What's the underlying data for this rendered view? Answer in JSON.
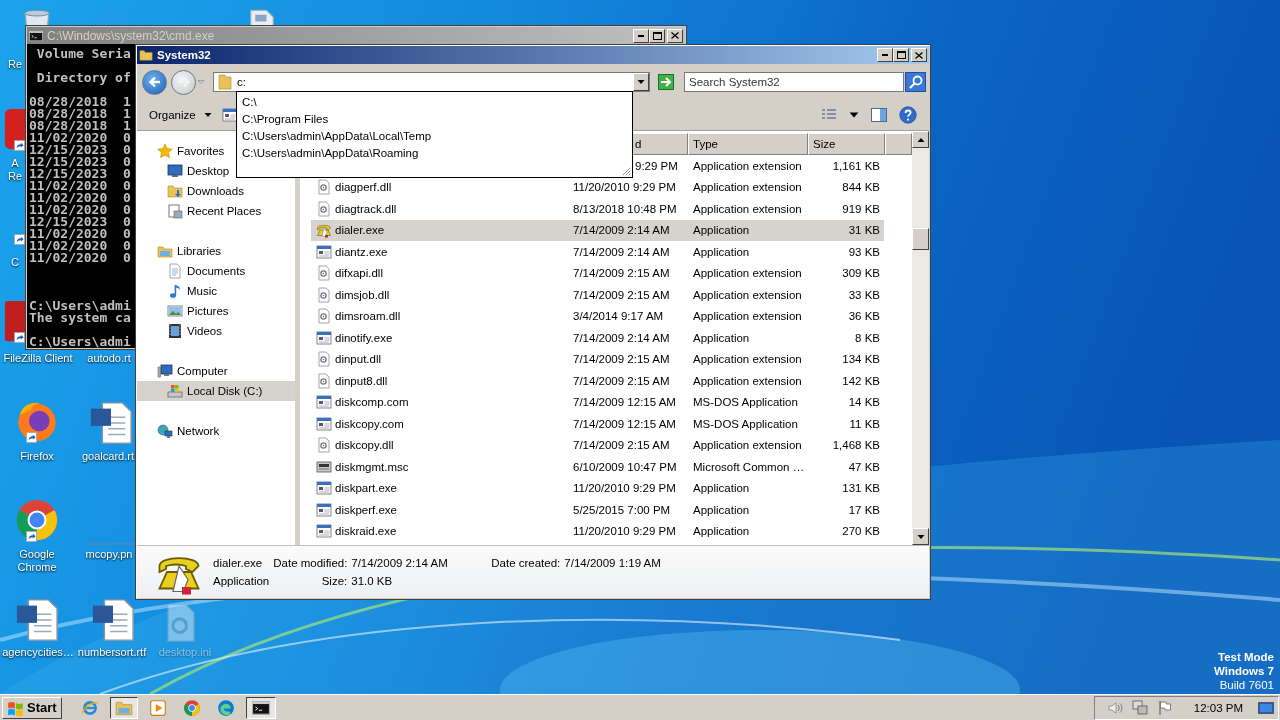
{
  "desktop_icons": [
    {
      "kind": "bin",
      "label": "Re",
      "shortcut": false
    },
    {
      "kind": "bubble",
      "shortcut": false
    },
    {
      "kind": "document",
      "shortcut": false
    },
    {
      "kind": "acrobat",
      "label": "A Re",
      "shortcut": true
    },
    {
      "kind": "none",
      "label": "C",
      "shortcut": true
    },
    {
      "kind": "filezilla",
      "label": "FileZilla Client",
      "shortcut": true
    },
    {
      "kind": "none",
      "label": "autodo.rt",
      "shortcut": false
    },
    {
      "kind": "firefox",
      "label": "Firefox",
      "shortcut": true
    },
    {
      "kind": "word",
      "label": "goalcard.rt",
      "shortcut": false
    },
    {
      "kind": "chrome",
      "label": "Google Chrome",
      "shortcut": true
    },
    {
      "kind": "thumb",
      "label": "mcopy.pn",
      "shortcut": false
    },
    {
      "kind": "word",
      "label": "agencycities…",
      "shortcut": false
    },
    {
      "kind": "word",
      "label": "numbersort.rtf",
      "shortcut": false
    },
    {
      "kind": "ini",
      "label": "desktop.ini",
      "shortcut": false
    }
  ],
  "system_notice": [
    {
      "text": "Test Mode",
      "emphasis": true
    },
    {
      "text": "Windows 7",
      "emphasis": true
    },
    {
      "text": "Build 7601",
      "emphasis": false
    }
  ],
  "console_window": {
    "title": "C:\\Windows\\system32\\cmd.exe",
    "blocks": [
      [
        " Volume Seria"
      ],
      [
        " Directory of"
      ],
      [
        "08/28/2018  1",
        "08/28/2018  1",
        "08/28/2018  1",
        "11/02/2020  0",
        "12/15/2023  0",
        "12/15/2023  0",
        "12/15/2023  0",
        "11/02/2020  0",
        "11/02/2020  0",
        "11/02/2020  0",
        "12/15/2023  0",
        "11/02/2020  0",
        "11/02/2020  0",
        "11/02/2020  0"
      ],
      [
        "C:\\Users\\admi",
        "The system ca"
      ],
      [
        "C:\\Users\\admi"
      ]
    ]
  },
  "explorer_window": {
    "title": "System32",
    "address": "c:",
    "search_placeholder": "Search System32",
    "autocomplete": [
      "C:\\",
      "C:\\Program Files",
      "C:\\Users\\admin\\AppData\\Local\\Temp",
      "C:\\Users\\admin\\AppData\\Roaming"
    ],
    "organize": "Organize",
    "nav": [
      {
        "label": "Favorites",
        "kind": "star",
        "selected": false,
        "children": [
          {
            "label": "Desktop",
            "kind": "desktop",
            "selected": false
          },
          {
            "label": "Downloads",
            "kind": "downloads",
            "selected": false
          },
          {
            "label": "Recent Places",
            "kind": "recent",
            "selected": false
          }
        ]
      },
      {
        "label": "Libraries",
        "kind": "library",
        "selected": false,
        "children": [
          {
            "label": "Documents",
            "kind": "documents",
            "selected": false
          },
          {
            "label": "Music",
            "kind": "music",
            "selected": false
          },
          {
            "label": "Pictures",
            "kind": "pictures",
            "selected": false
          },
          {
            "label": "Videos",
            "kind": "videos",
            "selected": false
          }
        ]
      },
      {
        "label": "Computer",
        "kind": "computer",
        "selected": false,
        "children": [
          {
            "label": "Local Disk (C:)",
            "kind": "disk",
            "selected": true
          }
        ]
      },
      {
        "label": "Network",
        "kind": "network",
        "selected": false
      }
    ],
    "columns": [
      "d",
      "Type",
      "Size"
    ],
    "files": [
      {
        "kind": "partial",
        "modified": "9:29 PM",
        "type": "Application extension",
        "size": "1,161 KB",
        "selected": false
      },
      {
        "kind": "extension",
        "name": "diagperf.dll",
        "modified": "11/20/2010 9:29 PM",
        "type": "Application extension",
        "size": "844 KB",
        "selected": false
      },
      {
        "kind": "extension",
        "name": "diagtrack.dll",
        "modified": "8/13/2018 10:48 PM",
        "type": "Application extension",
        "size": "919 KB",
        "selected": false
      },
      {
        "kind": "phone",
        "name": "dialer.exe",
        "modified": "7/14/2009 2:14 AM",
        "type": "Application",
        "size": "31 KB",
        "selected": true
      },
      {
        "kind": "window",
        "name": "diantz.exe",
        "modified": "7/14/2009 2:14 AM",
        "type": "Application",
        "size": "93 KB",
        "selected": false
      },
      {
        "kind": "extension",
        "name": "difxapi.dll",
        "modified": "7/14/2009 2:15 AM",
        "type": "Application extension",
        "size": "309 KB",
        "selected": false
      },
      {
        "kind": "extension",
        "name": "dimsjob.dll",
        "modified": "7/14/2009 2:15 AM",
        "type": "Application extension",
        "size": "33 KB",
        "selected": false
      },
      {
        "kind": "extension",
        "name": "dimsroam.dll",
        "modified": "3/4/2014 9:17 AM",
        "type": "Application extension",
        "size": "36 KB",
        "selected": false
      },
      {
        "kind": "window",
        "name": "dinotify.exe",
        "modified": "7/14/2009 2:14 AM",
        "type": "Application",
        "size": "8 KB",
        "selected": false
      },
      {
        "kind": "extension",
        "name": "dinput.dll",
        "modified": "7/14/2009 2:15 AM",
        "type": "Application extension",
        "size": "134 KB",
        "selected": false
      },
      {
        "kind": "extension",
        "name": "dinput8.dll",
        "modified": "7/14/2009 2:15 AM",
        "type": "Application extension",
        "size": "142 KB",
        "selected": false
      },
      {
        "kind": "window",
        "name": "diskcomp.com",
        "modified": "7/14/2009 12:15 AM",
        "type": "MS-DOS Application",
        "size": "14 KB",
        "selected": false
      },
      {
        "kind": "window",
        "name": "diskcopy.com",
        "modified": "7/14/2009 12:15 AM",
        "type": "MS-DOS Application",
        "size": "11 KB",
        "selected": false
      },
      {
        "kind": "extension",
        "name": "diskcopy.dll",
        "modified": "7/14/2009 2:15 AM",
        "type": "Application extension",
        "size": "1,468 KB",
        "selected": false
      },
      {
        "kind": "console",
        "name": "diskmgmt.msc",
        "modified": "6/10/2009 10:47 PM",
        "type": "Microsoft Common …",
        "size": "47 KB",
        "selected": false
      },
      {
        "kind": "window",
        "name": "diskpart.exe",
        "modified": "11/20/2010 9:29 PM",
        "type": "Application",
        "size": "131 KB",
        "selected": false
      },
      {
        "kind": "window",
        "name": "diskperf.exe",
        "modified": "5/25/2015 7:00 PM",
        "type": "Application",
        "size": "17 KB",
        "selected": false
      },
      {
        "kind": "window",
        "name": "diskraid.exe",
        "modified": "11/20/2010 9:29 PM",
        "type": "Application",
        "size": "270 KB",
        "selected": false
      }
    ],
    "details": {
      "kind": "phone",
      "name": "dialer.exe",
      "type": "Application",
      "fields": [
        {
          "label": "Date modified:",
          "value": "7/14/2009 2:14 AM"
        },
        {
          "label": "Date created:",
          "value": "7/14/2009 1:19 AM"
        },
        {
          "label": "Size:",
          "value": "31.0 KB"
        }
      ]
    }
  },
  "taskbar": {
    "start": "Start",
    "apps": [
      {
        "kind": "ie",
        "pressed": false
      },
      {
        "kind": "folder",
        "pressed": true
      },
      {
        "kind": "media",
        "pressed": false
      },
      {
        "kind": "chrome",
        "pressed": false
      },
      {
        "kind": "edge",
        "pressed": false
      },
      {
        "kind": "console",
        "pressed": true
      }
    ],
    "clock": "12:03 PM"
  }
}
